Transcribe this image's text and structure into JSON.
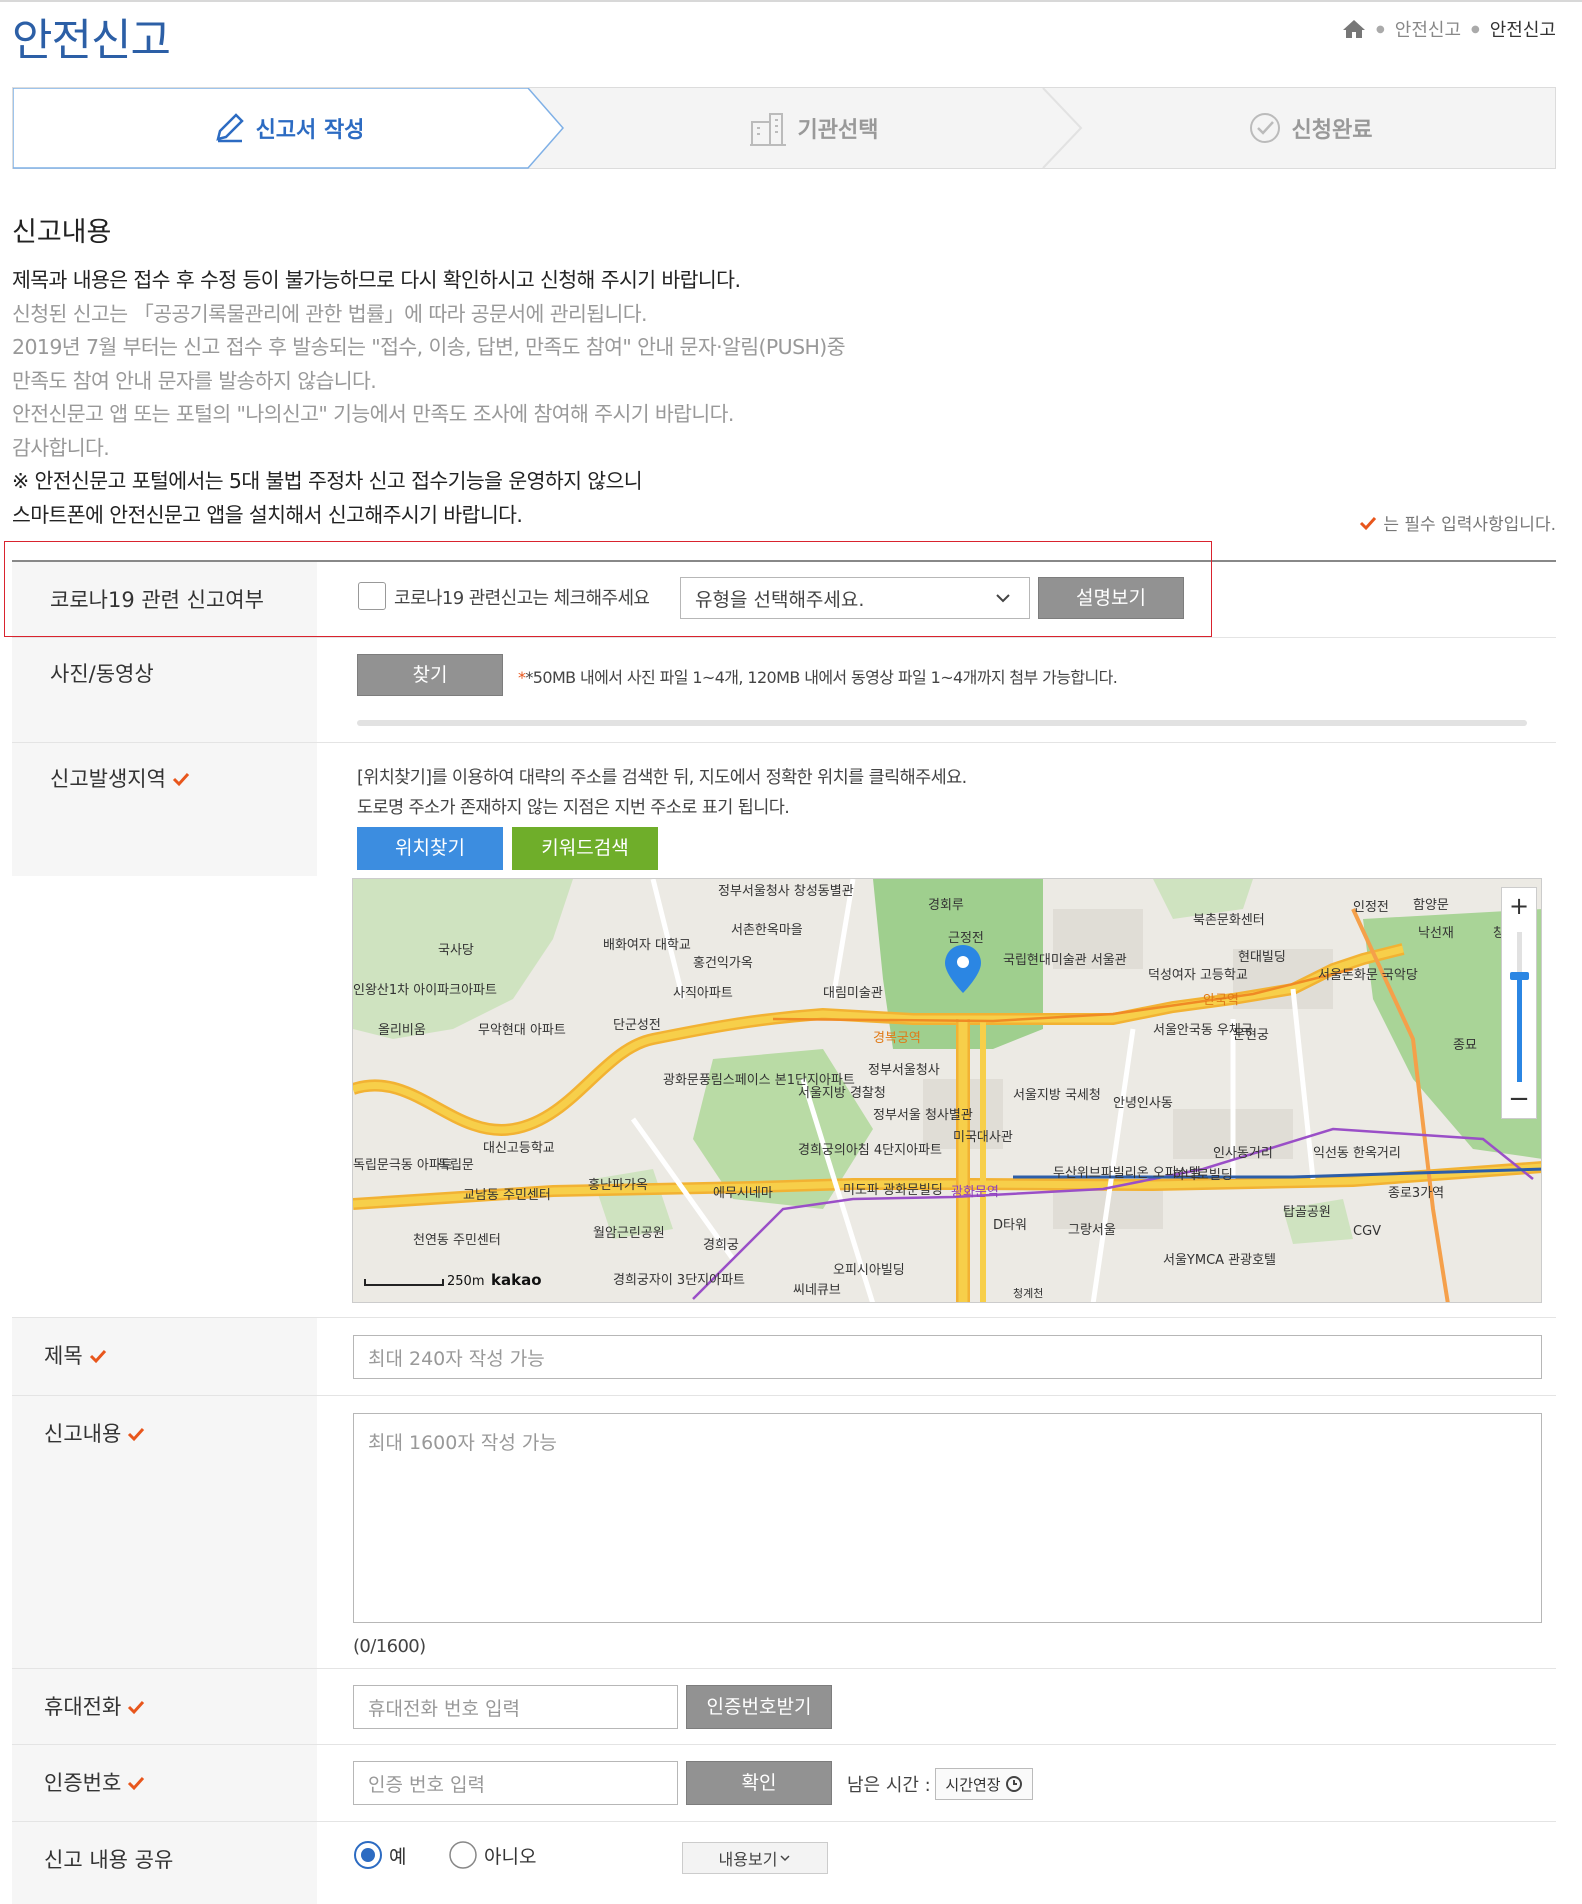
{
  "page": {
    "title": "안전신고",
    "breadcrumb": [
      "안전신고",
      "안전신고"
    ]
  },
  "steps": [
    {
      "label": "신고서 작성",
      "active": true
    },
    {
      "label": "기관선택",
      "active": false
    },
    {
      "label": "신청완료",
      "active": false
    }
  ],
  "section": {
    "title": "신고내용"
  },
  "notice": {
    "lines": [
      "제목과 내용은 접수 후 수정 등이 불가능하므로 다시 확인하시고 신청해 주시기 바랍니다.",
      "신청된 신고는 「공공기록물관리에 관한 법률」에 따라 공문서에 관리됩니다.",
      "2019년 7월 부터는 신고 접수 후 발송되는 \"접수, 이송, 답변, 만족도 참여\" 안내 문자·알림(PUSH)중",
      "만족도 참여 안내 문자를 발송하지 않습니다.",
      "안전신문고 앱 또는 포털의 \"나의신고\" 기능에서 만족도 조사에 참여해 주시기 바랍니다.",
      "감사합니다.",
      "※ 안전신문고 포털에서는 5대 불법 주정차 신고 접수기능을 운영하지 않으니",
      "스마트폰에 안전신문고 앱을 설치해서 신고해주시기 바랍니다."
    ],
    "required_note": "는 필수 입력사항입니다."
  },
  "form": {
    "corona": {
      "label": "코로나19 관련 신고여부",
      "checkbox_label": "코로나19 관련신고는 체크해주세요",
      "select_value": "유형을 선택해주세요.",
      "explain_button": "설명보기"
    },
    "media": {
      "label": "사진/동영상",
      "find_button": "찾기",
      "hint": "*50MB 내에서 사진 파일 1~4개, 120MB 내에서 동영상 파일 1~4개까지 첨부 가능합니다."
    },
    "location": {
      "label": "신고발생지역",
      "desc1": "[위치찾기]를 이용하여 대략의 주소를 검색한 뒤, 지도에서 정확한 위치를 클릭해주세요.",
      "desc2": "도로명 주소가 존재하지 않는 지점은 지번 주소로 표기 됩니다.",
      "find_location_button": "위치찾기",
      "keyword_button": "키워드검색"
    },
    "map": {
      "scale": "250m",
      "logo": "kakao",
      "labels": [
        "정부서울청사 창성동별관",
        "경회루",
        "서촌한옥마을",
        "근정전",
        "국립현대미술관 서울관",
        "덕성여자 고등학교",
        "북촌문화센터",
        "현대빌딩",
        "서울돈화문 국악당",
        "인정전",
        "함양문",
        "낙선재",
        "창경",
        "국사당",
        "배화여자 대학교",
        "홍건익가옥",
        "사직아파트",
        "대림미술관",
        "인왕산1차 아이파크아파트",
        "올리비움",
        "무악현대 아파트",
        "단군성전",
        "경복궁역",
        "서울안국동 우체국",
        "운현궁",
        "종묘",
        "안국역",
        "광화문풍림스페이스 본1단지아파트",
        "서울지방 경찰청",
        "정부서울청사",
        "서울지방 국세청",
        "안녕인사동",
        "정부서울 청사별관",
        "미국대사관",
        "대신고등학교",
        "독립문",
        "독립문극동 아파트",
        "경희궁의아침 4단지아파트",
        "인사동거리",
        "익선동 한옥거리",
        "교남동 주민센터",
        "홍난파가옥",
        "에무시네마",
        "미도파 광화문빌딩",
        "광화문역",
        "두산위브파빌리온 오피스텔",
        "하나로빌딩",
        "종로3가역",
        "천연동 주민센터",
        "월암근린공원",
        "경희궁",
        "D타워",
        "그랑서울",
        "탑골공원",
        "CGV",
        "서울YMCA 관광호텔",
        "오피시아빌딩",
        "씨네큐브",
        "경희궁자이 3단지아파트",
        "청계천"
      ]
    },
    "title": {
      "label": "제목",
      "placeholder": "최대 240자 작성 가능"
    },
    "content": {
      "label": "신고내용",
      "placeholder": "최대 1600자 작성 가능",
      "counter": "(0/1600)"
    },
    "phone": {
      "label": "휴대전화",
      "placeholder": "휴대전화 번호 입력",
      "button": "인증번호받기"
    },
    "auth": {
      "label": "인증번호",
      "placeholder": "인증 번호 입력",
      "button": "확인",
      "remain_label": "남은 시간 :",
      "extend_button": "시간연장"
    },
    "share": {
      "label": "신고 내용 공유",
      "yes": "예",
      "no": "아니오",
      "view_button": "내용보기",
      "selected": "예"
    }
  },
  "colors": {
    "accent": "#2c6bc2",
    "required": "#e8561c",
    "blue_btn": "#3c8de0",
    "green_btn": "#6fae2a",
    "highlight": "#d9232e"
  }
}
